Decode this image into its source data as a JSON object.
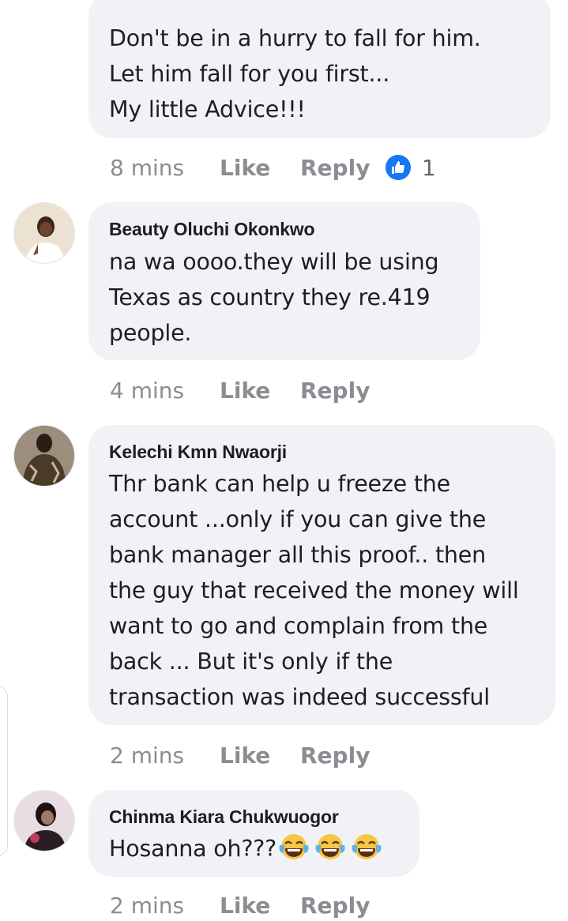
{
  "comments": [
    {
      "author": "",
      "text": "Don't be in a hurry to fall for him.\nLet him fall for you first...\nMy little Advice!!!",
      "time": "8 mins",
      "like_label": "Like",
      "reply_label": "Reply",
      "reaction_count": "1"
    },
    {
      "author": "Beauty Oluchi Okonkwo",
      "text": "na wa oooo.they will be using\nTexas as country they re.419\npeople.",
      "time": "4 mins",
      "like_label": "Like",
      "reply_label": "Reply"
    },
    {
      "author": "Kelechi Kmn Nwaorji",
      "text": "Thr bank can help u freeze the\naccount ...only if you can give the\nbank manager all this proof.. then\nthe guy that received the money will\nwant to go and complain from the\nback ... But it's only if the\ntransaction was indeed successful",
      "time": "2 mins",
      "like_label": "Like",
      "reply_label": "Reply"
    },
    {
      "author": "Chinma Kiara Chukwuogor",
      "text": "Hosanna oh???",
      "emoji": "face-with-tears-of-joy-icon x3",
      "time": "2 mins",
      "like_label": "Like",
      "reply_label": "Reply"
    }
  ],
  "colors": {
    "bubble": "#f0f2f5",
    "meta_text": "#8a8d91",
    "like_blue": "#1877f2",
    "body_text": "#1c1e21"
  }
}
